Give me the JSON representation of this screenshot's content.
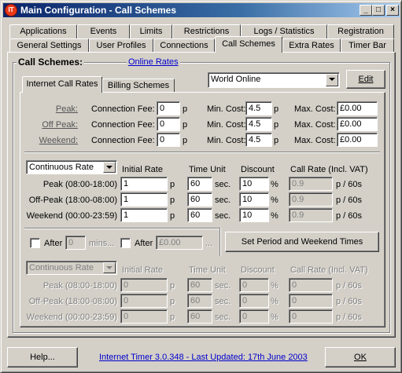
{
  "window": {
    "title": "Main Configuration - Call Schemes",
    "icon_label": "IT",
    "minimize_glyph": "_",
    "maximize_glyph": "□",
    "close_glyph": "×"
  },
  "tabs_row1": [
    "Applications",
    "Events",
    "Limits",
    "Restrictions",
    "Logs / Statistics",
    "Registration"
  ],
  "tabs_row2": [
    "General Settings",
    "User Profiles",
    "Connections",
    "Call Schemes",
    "Extra Rates",
    "Timer Bar"
  ],
  "call_schemes": {
    "label": "Call Schemes:",
    "online_rates_link": "Online Rates",
    "subtab_internet": "Internet Call Rates",
    "subtab_billing": "Billing Schemes",
    "isp_selected": "World Online",
    "edit_button": "Edit"
  },
  "fees": {
    "rows": [
      {
        "name": "Peak:",
        "conn_label": "Connection Fee:",
        "conn_value": "0",
        "conn_unit": "p",
        "min_label": "Min. Cost:",
        "min_value": "4.5",
        "min_unit": "p",
        "max_label": "Max. Cost:",
        "max_value": "£0.00"
      },
      {
        "name": "Off Peak:",
        "conn_label": "Connection Fee:",
        "conn_value": "0",
        "conn_unit": "p",
        "min_label": "Min. Cost:",
        "min_value": "4.5",
        "min_unit": "p",
        "max_label": "Max. Cost:",
        "max_value": "£0.00"
      },
      {
        "name": "Weekend:",
        "conn_label": "Connection Fee:",
        "conn_value": "0",
        "conn_unit": "p",
        "min_label": "Min. Cost:",
        "min_value": "4.5",
        "min_unit": "p",
        "max_label": "Max. Cost:",
        "max_value": "£0.00"
      }
    ]
  },
  "rates1": {
    "rate_type": "Continuous Rate",
    "headers": {
      "initial": "Initial Rate",
      "time_unit": "Time Unit",
      "discount": "Discount",
      "call_rate": "Call Rate  (Incl. VAT)"
    },
    "rows": [
      {
        "period": "Peak (08:00-18:00)",
        "initial": "1",
        "initial_unit": "p",
        "time": "60",
        "time_unit": "sec.",
        "discount": "10",
        "discount_unit": "%",
        "call_rate": "0.9",
        "rate_unit": "p / 60s"
      },
      {
        "period": "Off-Peak (18:00-08:00)",
        "initial": "1",
        "initial_unit": "p",
        "time": "60",
        "time_unit": "sec.",
        "discount": "10",
        "discount_unit": "%",
        "call_rate": "0.9",
        "rate_unit": "p / 60s"
      },
      {
        "period": "Weekend (00:00-23:59)",
        "initial": "1",
        "initial_unit": "p",
        "time": "60",
        "time_unit": "sec.",
        "discount": "10",
        "discount_unit": "%",
        "call_rate": "0.9",
        "rate_unit": "p / 60s"
      }
    ]
  },
  "after": {
    "after_label": "After",
    "mins_value": "0",
    "mins_label": "mins...",
    "after2_label": "After",
    "cost_value": "£0.00",
    "cost_suffix": "...",
    "set_period_button": "Set Period and Weekend Times"
  },
  "rates2": {
    "rate_type": "Continuous Rate",
    "headers": {
      "initial": "Initial Rate",
      "time_unit": "Time Unit",
      "discount": "Discount",
      "call_rate": "Call Rate  (Incl. VAT)"
    },
    "rows": [
      {
        "period": "Peak (08:00-18:00)",
        "initial": "0",
        "initial_unit": "p",
        "time": "60",
        "time_unit": "sec.",
        "discount": "0",
        "discount_unit": "%",
        "call_rate": "0",
        "rate_unit": "p / 60s"
      },
      {
        "period": "Off-Peak (18:00-08:00)",
        "initial": "0",
        "initial_unit": "p",
        "time": "60",
        "time_unit": "sec.",
        "discount": "0",
        "discount_unit": "%",
        "call_rate": "0",
        "rate_unit": "p / 60s"
      },
      {
        "period": "Weekend (00:00-23:59)",
        "initial": "0",
        "initial_unit": "p",
        "time": "60",
        "time_unit": "sec.",
        "discount": "0",
        "discount_unit": "%",
        "call_rate": "0",
        "rate_unit": "p / 60s"
      }
    ]
  },
  "footer": {
    "help_button": "Help...",
    "version_link": "Internet Timer 3.0.348 - Last Updated: 17th June 2003",
    "ok_button": "OK"
  }
}
